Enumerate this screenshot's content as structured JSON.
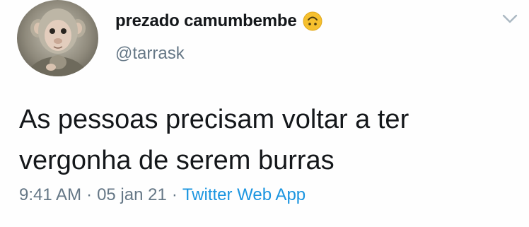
{
  "user": {
    "display_name": "prezado camumbembe",
    "handle": "@tarrask",
    "name_emoji": "upside-down-face-emoji",
    "avatar": "monkey-avatar"
  },
  "tweet": {
    "text_lines": [
      "As pessoas precisam voltar a ter",
      "vergonha de serem burras"
    ]
  },
  "meta": {
    "time": "9:41 AM",
    "separator": "·",
    "date": "05 jan 21",
    "source": "Twitter Web App"
  },
  "menu": {
    "icon": "chevron-down-icon"
  },
  "colors": {
    "text": "#14171a",
    "secondary": "#657786",
    "link": "#1b95e0",
    "emoji": "#f6c02e"
  }
}
